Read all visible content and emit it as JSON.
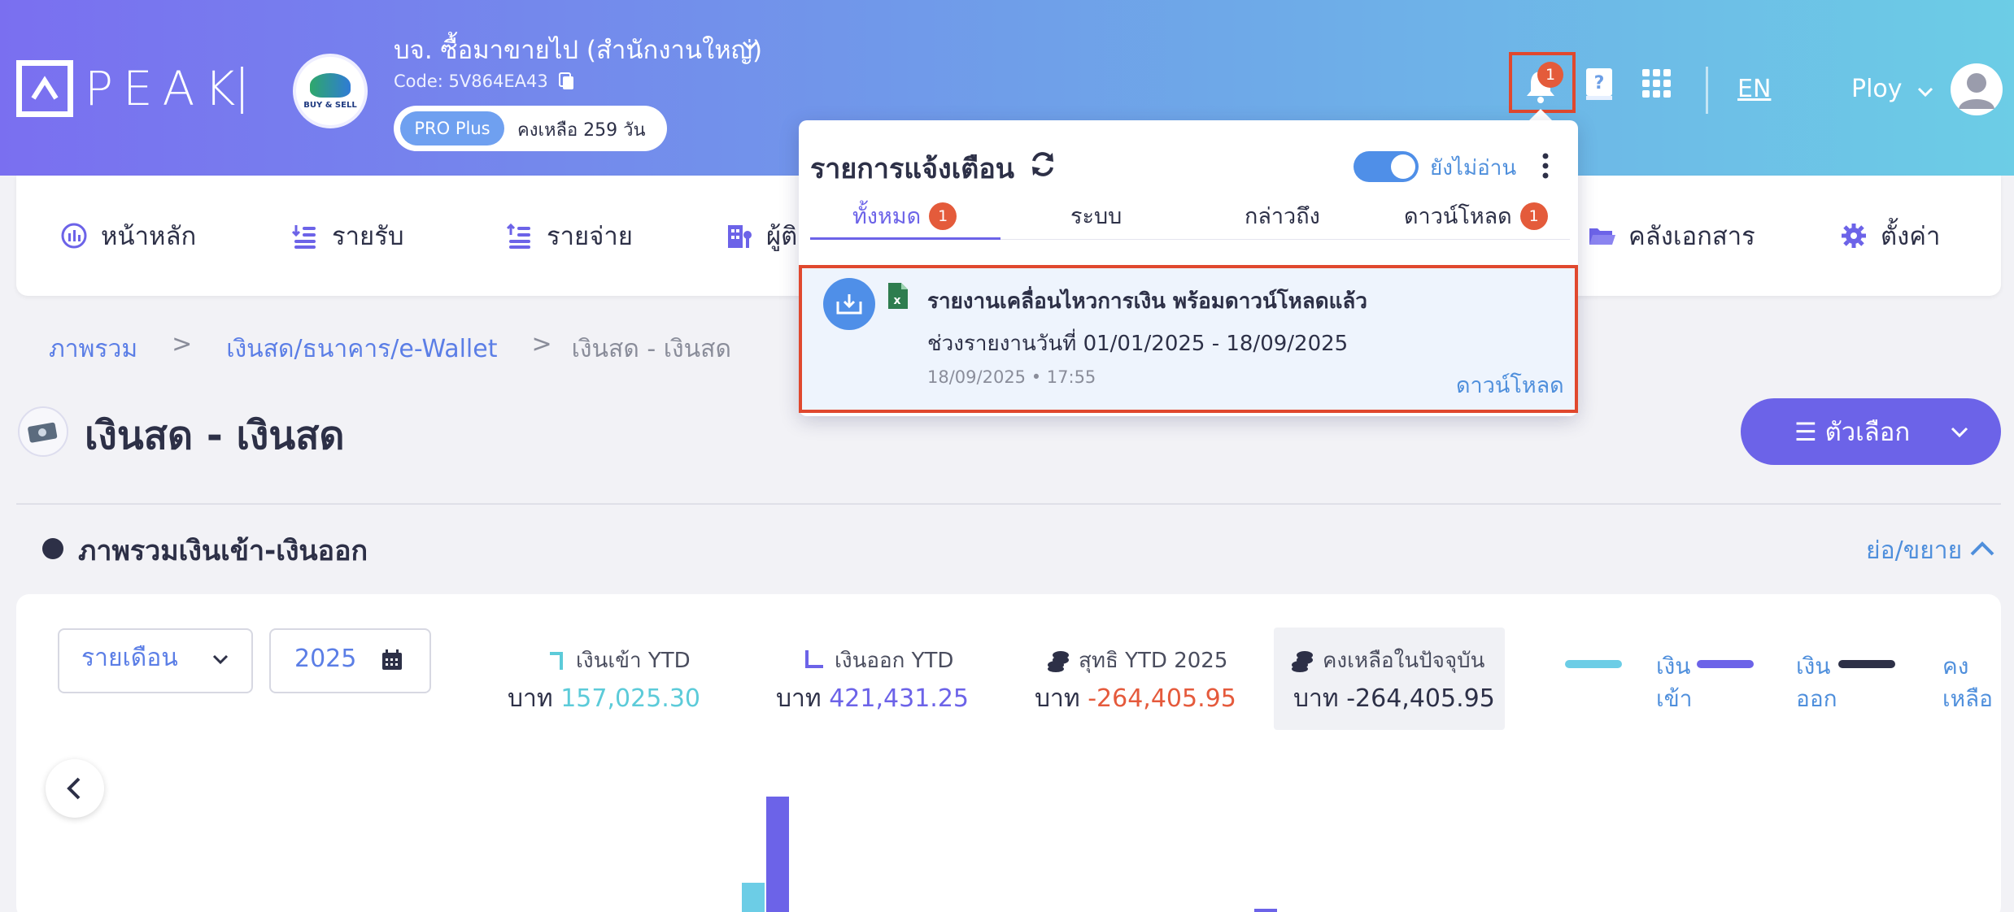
{
  "header": {
    "logo_text": "PEAK",
    "company_name": "บจ. ซื้อมาขายไป (สำนักงานใหญ่)",
    "company_code": "Code: 5V864EA43",
    "company_avatar_text": "BUY & SELL",
    "plan_badge": "PRO Plus",
    "plan_remaining": "คงเหลือ 259 วัน",
    "notification_count": "1",
    "language": "EN",
    "user_name": "Ploy"
  },
  "nav": {
    "items": [
      {
        "label": "หน้าหลัก",
        "icon": "dashboard-icon"
      },
      {
        "label": "รายรับ",
        "icon": "income-icon"
      },
      {
        "label": "รายจ่าย",
        "icon": "expense-icon"
      },
      {
        "label": "ผู้ติ",
        "icon": "contacts-icon"
      },
      {
        "label": "คลังเอกสาร",
        "icon": "folder-icon"
      },
      {
        "label": "ตั้งค่า",
        "icon": "gear-icon"
      }
    ]
  },
  "breadcrumb": {
    "items": [
      "ภาพรวม",
      "เงินสด/ธนาคาร/e-Wallet",
      "เงินสด - เงินสด"
    ],
    "separator": ">"
  },
  "page": {
    "title": "เงินสด - เงินสด",
    "options_label": "☰ ตัวเลือก",
    "section_title": "ภาพรวมเงินเข้า-เงินออก",
    "collapse_label": "ย่อ/ขยาย"
  },
  "filters": {
    "period": "รายเดือน",
    "year": "2025"
  },
  "stats": [
    {
      "label": "เงินเข้า YTD",
      "currency": "บาท",
      "value": "157,025.30",
      "color": "#5ccbd9"
    },
    {
      "label": "เงินออก YTD",
      "currency": "บาท",
      "value": "421,431.25",
      "color": "#6c63e8"
    },
    {
      "label": "สุทธิ YTD 2025",
      "currency": "บาท",
      "value": "-264,405.95",
      "color": "#e55a3c"
    },
    {
      "label": "คงเหลือในปัจจุบัน",
      "currency": "บาท",
      "value": "-264,405.95",
      "color": "#2d3047"
    }
  ],
  "legend": [
    {
      "line1": "เงิน",
      "line2": "เข้า",
      "color": "#6ccde6"
    },
    {
      "line1": "เงิน",
      "line2": "ออก",
      "color": "#6c63e8"
    },
    {
      "line1": "คง",
      "line2": "เหลือ",
      "color": "#2d3047"
    }
  ],
  "notifications": {
    "title": "รายการแจ้งเตือน",
    "unread_label": "ยังไม่อ่าน",
    "tabs": [
      {
        "label": "ทั้งหมด",
        "badge": "1"
      },
      {
        "label": "ระบบ",
        "badge": ""
      },
      {
        "label": "กล่าวถึง",
        "badge": ""
      },
      {
        "label": "ดาวน์โหลด",
        "badge": "1"
      }
    ],
    "item": {
      "heading": "รายงานเคลื่อนไหวการเงิน พร้อมดาวน์โหลดแล้ว",
      "range": "ช่วงรายงานวันที่ 01/01/2025 - 18/09/2025",
      "time": "18/09/2025 • 17:55",
      "action": "ดาวน์โหลด"
    }
  }
}
